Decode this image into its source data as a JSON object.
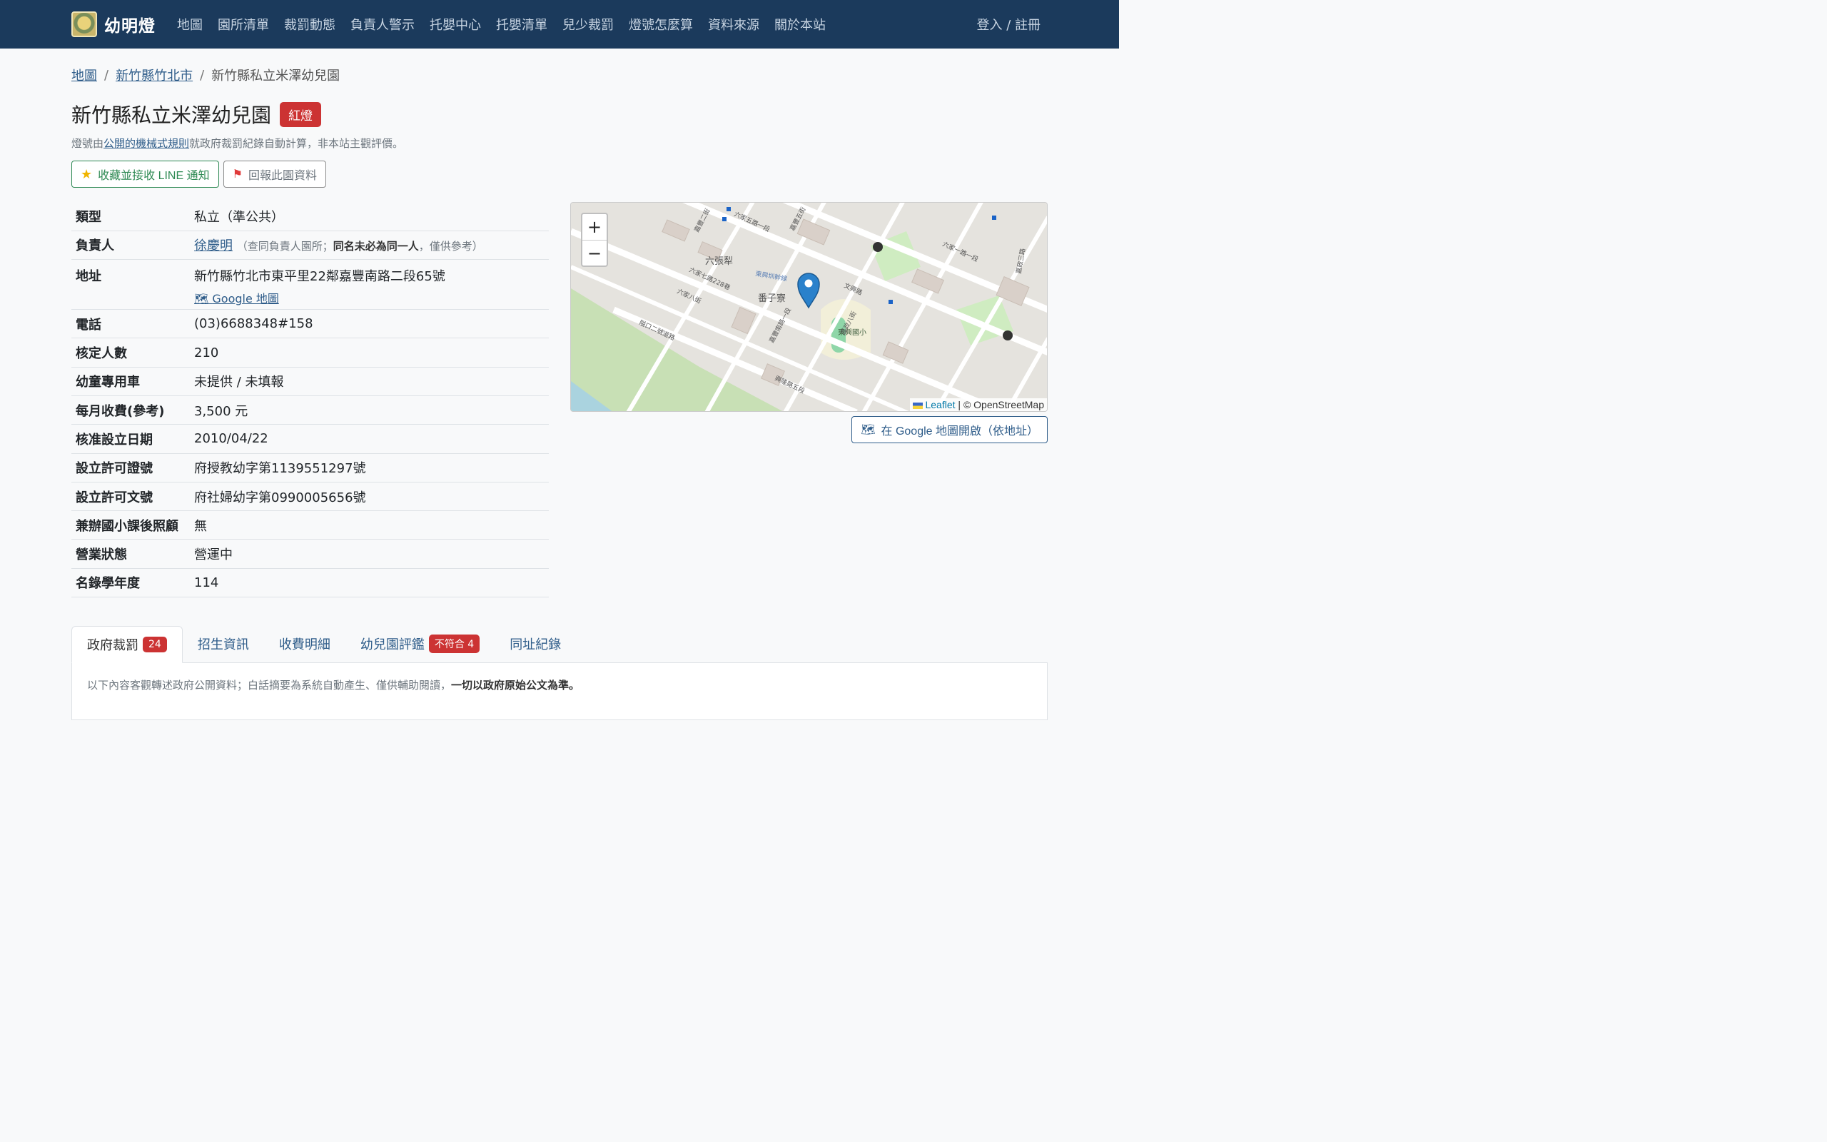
{
  "nav": {
    "brand": "幼明燈",
    "links": [
      "地圖",
      "園所清單",
      "裁罰動態",
      "負責人警示",
      "托嬰中心",
      "托嬰清單",
      "兒少裁罰",
      "燈號怎麼算",
      "資料來源",
      "關於本站"
    ],
    "login": "登入 / 註冊"
  },
  "breadcrumb": {
    "home": "地圖",
    "sep": "/",
    "city": "新竹縣竹北市",
    "current": "新竹縣私立米澤幼兒園"
  },
  "header": {
    "title": "新竹縣私立米澤幼兒園",
    "badge": "紅燈",
    "badge_color": "#cc3333",
    "subtitle_pre": "燈號由",
    "subtitle_link": "公開的機械式規則",
    "subtitle_post": "就政府裁罰紀錄自動計算，非本站主觀評價。"
  },
  "actions": {
    "favorite": "收藏並接收 LINE 通知",
    "report": "回報此園資料"
  },
  "info": {
    "type_k": "類型",
    "type_v": "私立（準公共）",
    "owner_k": "負責人",
    "owner_v": "徐慶明",
    "owner_note_a": "（查同負責人園所；",
    "owner_note_b": "同名未必為同一人",
    "owner_note_c": "，僅供參考）",
    "addr_k": "地址",
    "addr_v": "新竹縣竹北市東平里22鄰嘉豐南路二段65號",
    "addr_map": "Google 地圖",
    "phone_k": "電話",
    "phone_v": "(03)6688348#158",
    "capacity_k": "核定人數",
    "capacity_v": "210",
    "bus_k": "幼童專用車",
    "bus_v": "未提供 / 未填報",
    "fee_k": "每月收費(參考)",
    "fee_v": "3,500 元",
    "date_k": "核准設立日期",
    "date_v": "2010/04/22",
    "license_k": "設立許可證號",
    "license_v": "府授教幼字第1139551297號",
    "doc_k": "設立許可文號",
    "doc_v": "府社婦幼字第0990005656號",
    "afterschool_k": "兼辦國小課後照顧",
    "afterschool_v": "無",
    "status_k": "營業狀態",
    "status_v": "營運中",
    "year_k": "名錄學年度",
    "year_v": "114"
  },
  "map": {
    "zoom_in": "+",
    "zoom_out": "−",
    "attr_leaflet": "Leaflet",
    "attr_osm": "| © OpenStreetMap",
    "labels": [
      "六張犁",
      "番子寮",
      "東興國小",
      "東興圳幹線",
      "六家七路228巷",
      "六家八街",
      "六家五路一段",
      "嘉豐南路一段",
      "嘉豐二街",
      "六家一路一段",
      "文興路",
      "嘉政八街",
      "嘉政三路",
      "嘉豐五街",
      "隘口二號道路",
      "興隆路五段"
    ],
    "open_btn": "在 Google 地圖開啟（依地址）"
  },
  "tabs": {
    "t1": "政府裁罰",
    "t1_count": "24",
    "t2": "招生資訊",
    "t3": "收費明細",
    "t4": "幼兒園評鑑",
    "t4_count": "不符合 4",
    "t5": "同址紀錄"
  },
  "panel": {
    "text": "以下內容客觀轉述政府公開資料；白話摘要為系統自動產生、僅供輔助閱讀，",
    "bold": "一切以政府原始公文為準。"
  }
}
